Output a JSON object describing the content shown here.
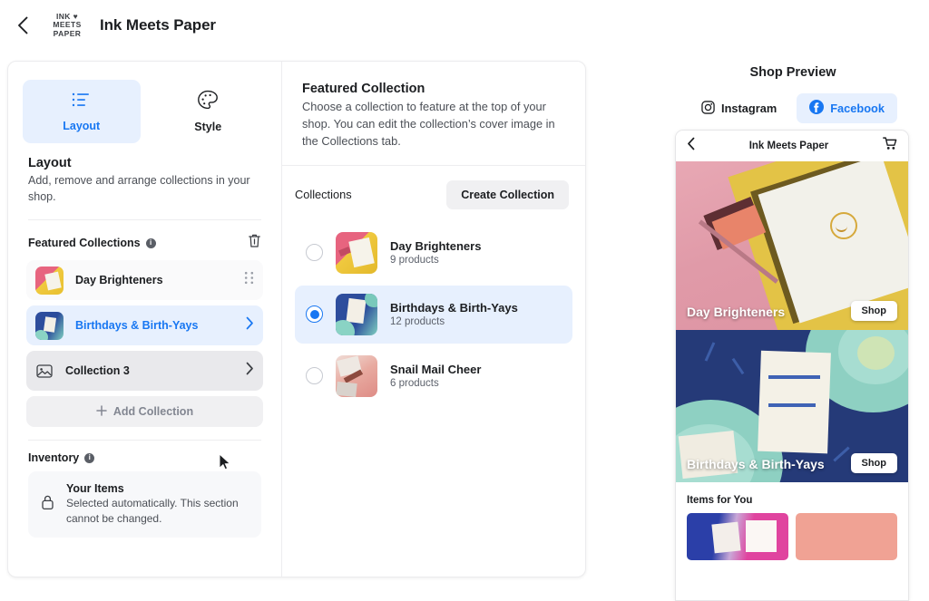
{
  "header": {
    "back_icon": "back-chevron-icon",
    "logo_lines": [
      "INK ♥",
      "MEETS",
      "PAPER"
    ],
    "brand_title": "Ink Meets Paper"
  },
  "editor": {
    "tabs": [
      {
        "label": "Layout",
        "icon": "layout-list-icon",
        "active": true
      },
      {
        "label": "Style",
        "icon": "palette-icon",
        "active": false
      }
    ],
    "layout_section": {
      "title": "Layout",
      "description": "Add, remove and arrange collections in your shop."
    },
    "featured": {
      "heading": "Featured Collections",
      "info_icon": "info-icon",
      "delete_icon": "trash-icon",
      "rows": [
        {
          "name": "Day Brighteners",
          "state": "plain",
          "trailing_icon": "drag-handle-icon",
          "thumb": "day-brighteners"
        },
        {
          "name": "Birthdays & Birth-Yays",
          "state": "selected",
          "trailing_icon": "chevron-right-icon",
          "thumb": "birthdays"
        },
        {
          "name": "Collection 3",
          "state": "hovered",
          "trailing_icon": "chevron-right-icon",
          "thumb": "placeholder"
        }
      ],
      "add_label": "Add Collection",
      "add_icon": "plus-icon"
    },
    "inventory": {
      "heading": "Inventory",
      "info_icon": "info-icon",
      "lock_icon": "lock-icon",
      "item_title": "Your Items",
      "item_desc": "Selected automatically. This section cannot be changed."
    }
  },
  "middle": {
    "title": "Featured Collection",
    "description": "Choose a collection to feature at the top of your shop. You can edit the collection’s cover image in the Collections tab.",
    "toolbar_label": "Collections",
    "create_button": "Create Collection",
    "options": [
      {
        "name": "Day Brighteners",
        "count": "9 products",
        "selected": false,
        "thumb": "day-brighteners"
      },
      {
        "name": "Birthdays & Birth-Yays",
        "count": "12 products",
        "selected": true,
        "thumb": "birthdays"
      },
      {
        "name": "Snail Mail Cheer",
        "count": "6 products",
        "selected": false,
        "thumb": "snail-mail"
      }
    ]
  },
  "preview": {
    "title": "Shop Preview",
    "channels": [
      {
        "label": "Instagram",
        "icon": "instagram-icon",
        "active": false
      },
      {
        "label": "Facebook",
        "icon": "facebook-icon",
        "active": true
      }
    ],
    "phone": {
      "back_icon": "back-chevron-icon",
      "title": "Ink Meets Paper",
      "cart_icon": "cart-icon",
      "banners": [
        {
          "label": "Day Brighteners",
          "shop_label": "Shop",
          "art": "day-brighteners"
        },
        {
          "label": "Birthdays & Birth-Yays",
          "shop_label": "Shop",
          "art": "birthdays"
        }
      ],
      "items_heading": "Items for You"
    }
  },
  "colors": {
    "accent_blue": "#1877f2",
    "accent_blue_bg": "#e7f0fe",
    "neutral_bg": "#f0f0f2",
    "hover_bg": "#e9e9ec"
  }
}
